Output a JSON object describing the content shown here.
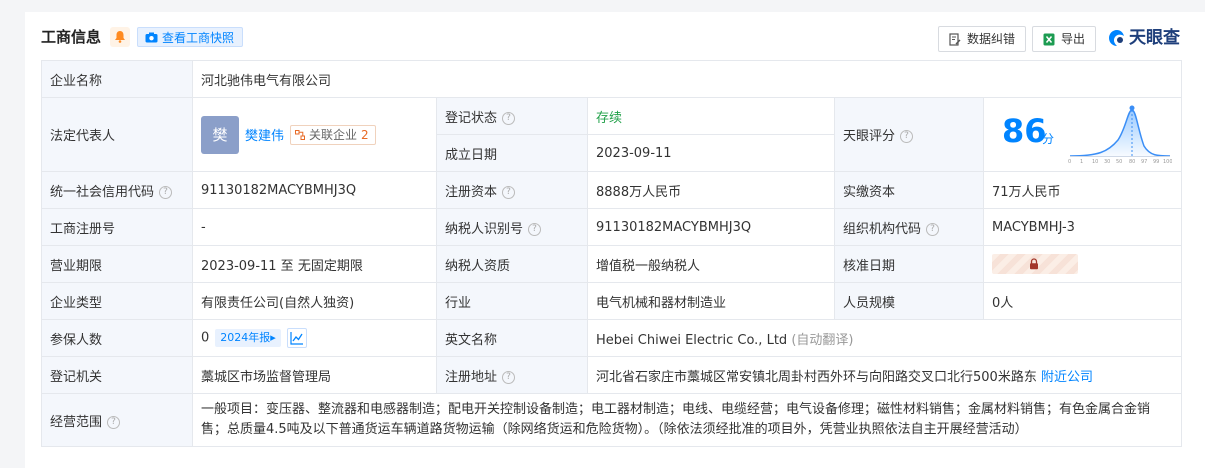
{
  "header": {
    "title": "工商信息",
    "snapshot_label": "查看工商快照",
    "correct_label": "数据纠错",
    "export_label": "导出",
    "brand": "天眼查"
  },
  "company": {
    "name_label": "企业名称",
    "name": "河北驰伟电气有限公司",
    "legal_rep_label": "法定代表人",
    "legal_rep_avatar": "樊",
    "legal_rep_name": "樊建伟",
    "related_label": "关联企业",
    "related_count": "2",
    "reg_status_label": "登记状态",
    "reg_status": "存续",
    "established_label": "成立日期",
    "established": "2023-09-11",
    "score_label": "天眼评分",
    "score": "86",
    "score_unit": "分",
    "score_ticks": [
      "0",
      "1",
      "10",
      "30",
      "50",
      "80",
      "97",
      "99",
      "100"
    ],
    "credit_code_label": "统一社会信用代码",
    "credit_code": "91130182MACYBMHJ3Q",
    "reg_capital_label": "注册资本",
    "reg_capital": "8888万人民币",
    "paid_capital_label": "实缴资本",
    "paid_capital": "71万人民币",
    "reg_no_label": "工商注册号",
    "reg_no": "-",
    "taxpayer_id_label": "纳税人识别号",
    "taxpayer_id": "91130182MACYBMHJ3Q",
    "org_code_label": "组织机构代码",
    "org_code": "MACYBMHJ-3",
    "term_label": "营业期限",
    "term": "2023-09-11 至 无固定期限",
    "tax_qual_label": "纳税人资质",
    "tax_qual": "增值税一般纳税人",
    "approve_date_label": "核准日期",
    "type_label": "企业类型",
    "type": "有限责任公司(自然人独资)",
    "industry_label": "行业",
    "industry": "电气机械和器材制造业",
    "staff_label": "人员规模",
    "staff": "0人",
    "insured_label": "参保人数",
    "insured": "0",
    "report_badge": "2024年报▸",
    "english_name_label": "英文名称",
    "english_name": "Hebei Chiwei Electric Co., Ltd",
    "auto_translate": "(自动翻译)",
    "authority_label": "登记机关",
    "authority": "藁城区市场监督管理局",
    "address_label": "注册地址",
    "address": "河北省石家庄市藁城区常安镇北周卦村西外环与向阳路交叉口北行500米路东",
    "nearby_label": "附近公司",
    "scope_label": "经营范围",
    "scope": "一般项目：变压器、整流器和电感器制造；配电开关控制设备制造；电工器材制造；电线、电缆经营；电气设备修理；磁性材料销售；金属材料销售；有色金属合金销售；总质量4.5吨及以下普通货运车辆道路货物运输（除网络货运和危险货物）。（除依法须经批准的项目外，凭营业执照依法自主开展经营活动）"
  },
  "colors": {
    "accent": "#0084ff",
    "status_green": "#22a14a",
    "label_bg": "#f4f7fc",
    "border": "#e5e8ed"
  },
  "icons": [
    "bell-icon",
    "camera-icon",
    "edit-doc-icon",
    "excel-icon",
    "brand-logo-icon",
    "help-icon",
    "related-icon",
    "trend-icon",
    "lock-icon"
  ]
}
